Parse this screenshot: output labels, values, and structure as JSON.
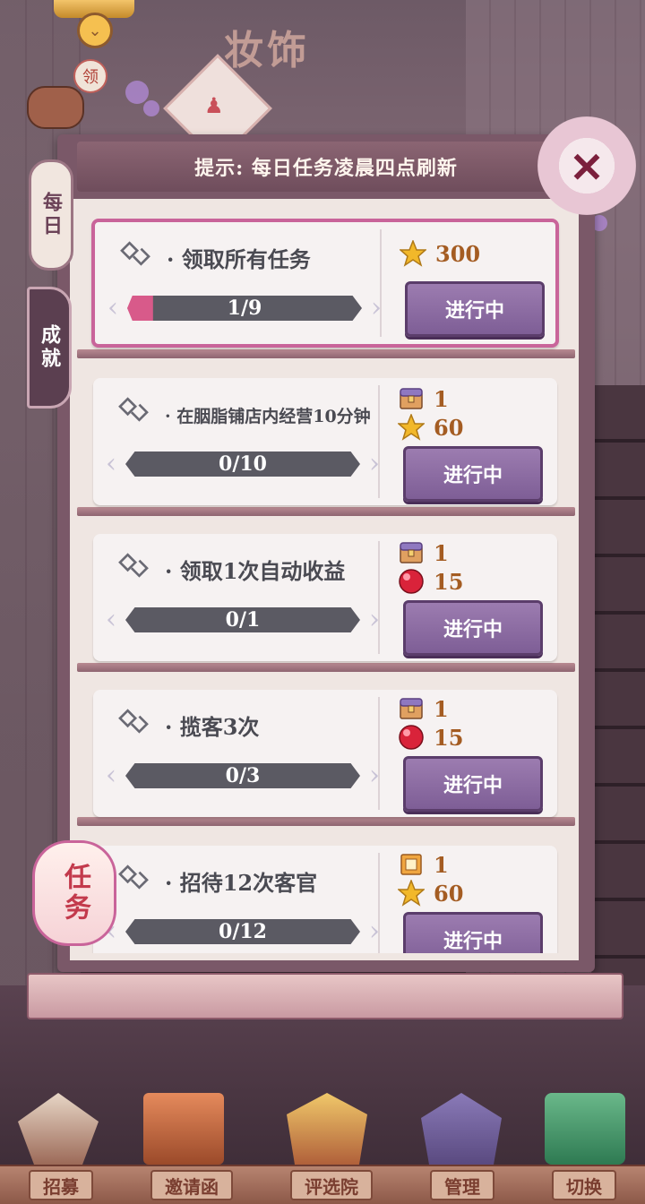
{
  "header": {
    "sign_text": "妆饰",
    "badge_ling": "领"
  },
  "panel": {
    "hint": "提示: 每日任务凌晨四点刷新"
  },
  "tabs": [
    {
      "label": "每日",
      "active": true
    },
    {
      "label": "成就",
      "active": false
    }
  ],
  "tasks": [
    {
      "title": "· 领取所有任务",
      "progress_text": "1/9",
      "progress_fraction": 0.11,
      "rewards": [
        {
          "icon": "star-icon",
          "value": "300"
        }
      ],
      "status": "进行中",
      "highlighted": true
    },
    {
      "title": "· 在胭脂铺店内经营10分钟",
      "progress_text": "0/10",
      "progress_fraction": 0,
      "rewards": [
        {
          "icon": "chest-icon",
          "value": "1"
        },
        {
          "icon": "star-icon",
          "value": "60"
        }
      ],
      "status": "进行中"
    },
    {
      "title": "· 领取1次自动收益",
      "progress_text": "0/1",
      "progress_fraction": 0,
      "rewards": [
        {
          "icon": "chest-icon",
          "value": "1"
        },
        {
          "icon": "red-orb-icon",
          "value": "15"
        }
      ],
      "status": "进行中"
    },
    {
      "title": "· 揽客3次",
      "progress_text": "0/3",
      "progress_fraction": 0,
      "rewards": [
        {
          "icon": "chest-icon",
          "value": "1"
        },
        {
          "icon": "red-orb-icon",
          "value": "15"
        }
      ],
      "status": "进行中"
    },
    {
      "title": "· 招待12次客官",
      "progress_text": "0/12",
      "progress_fraction": 0,
      "rewards": [
        {
          "icon": "scroll-icon",
          "value": "1"
        },
        {
          "icon": "star-icon",
          "value": "60"
        }
      ],
      "status": "进行中"
    }
  ],
  "lantern": "任务",
  "bottom_nav": [
    {
      "label": "招募"
    },
    {
      "label": "邀请函"
    },
    {
      "label": "评选院"
    },
    {
      "label": "管理"
    },
    {
      "label": "切换"
    }
  ]
}
